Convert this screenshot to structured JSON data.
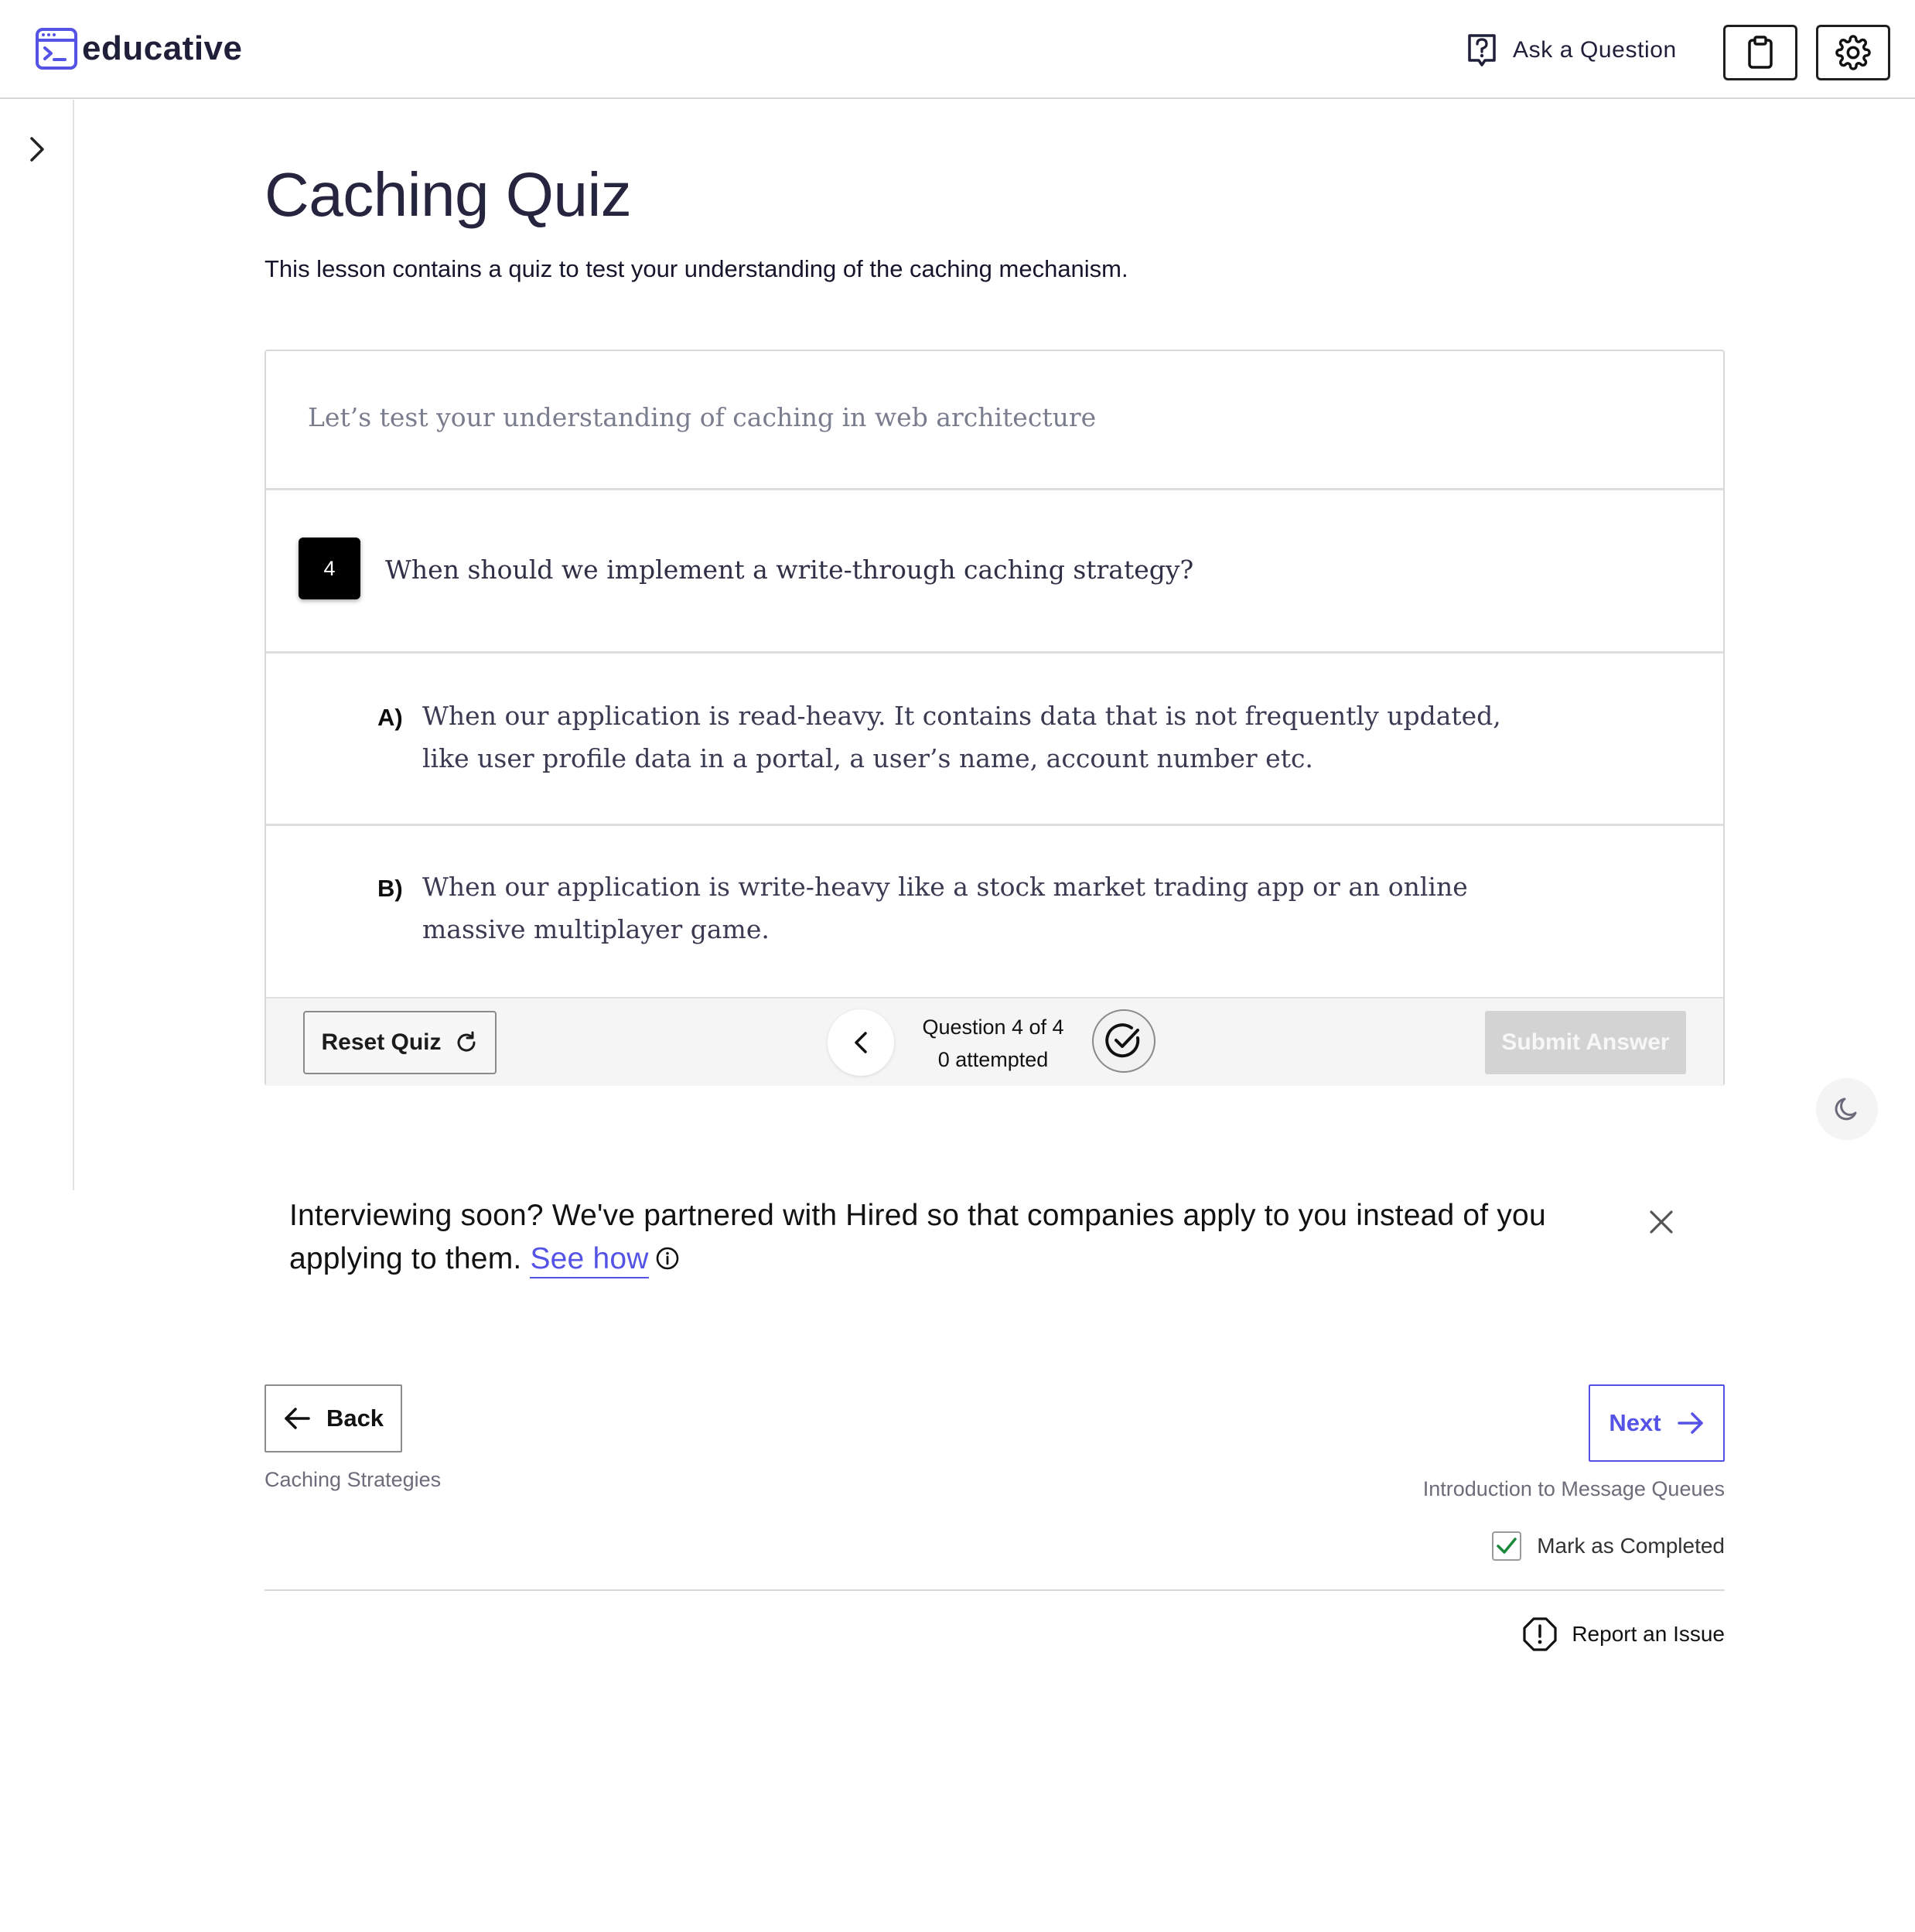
{
  "header": {
    "brand": "educative",
    "ask_label": "Ask a Question"
  },
  "lesson": {
    "title": "Caching Quiz",
    "description": "This lesson contains a quiz to test your understanding of the caching mechanism."
  },
  "quiz": {
    "intro": "Let’s test your understanding of caching in web architecture",
    "question_number": "4",
    "question": "When should we implement a write-through caching strategy?",
    "options": [
      {
        "letter": "A)",
        "text": "When our application is read-heavy. It contains data that is not frequently updated, like user profile data in a portal, a user’s name, account number etc."
      },
      {
        "letter": "B)",
        "text": "When our application is write-heavy like a stock market trading app or an online massive multiplayer game."
      }
    ],
    "reset_label": "Reset Quiz",
    "progress": "Question 4 of 4",
    "attempted": "0 attempted",
    "submit_label": "Submit Answer"
  },
  "banner": {
    "text": "Interviewing soon? We've partnered with Hired so that companies apply to you instead of you applying to them.",
    "link_label": "See how"
  },
  "navigation": {
    "back_label": "Back",
    "back_lesson": "Caching Strategies",
    "next_label": "Next",
    "next_lesson": "Introduction to Message Queues",
    "mark_completed_label": "Mark as Completed",
    "mark_completed_checked": true,
    "report_label": "Report an Issue"
  },
  "colors": {
    "brand": "#5553e6",
    "title": "#25253f",
    "check_green": "#1a8a3a",
    "submit_disabled": "#d3d3d3"
  }
}
